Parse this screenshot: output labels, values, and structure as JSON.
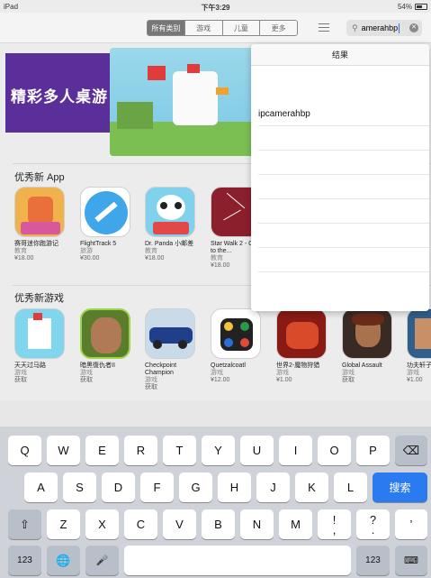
{
  "status": {
    "device": "iPad",
    "time": "下午3:29",
    "battery": "54%"
  },
  "nav": {
    "segments": [
      "所有类别",
      "游戏",
      "儿童",
      "更多"
    ],
    "selected_segment": "所有类别",
    "search_value": "amerahbp",
    "search_icon": "magnifier-icon",
    "clear_icon": "clear-icon"
  },
  "banner": {
    "headline": "精彩多人桌游"
  },
  "sections": [
    {
      "title": "优秀新 App",
      "apps": [
        {
          "name": "赛哥迷你跑游记",
          "category": "教育",
          "price": "¥18.00"
        },
        {
          "name": "FlightTrack 5",
          "category": "旅游",
          "price": "¥30.00"
        },
        {
          "name": "Dr. Panda 小邮差",
          "category": "教育",
          "price": "¥18.00"
        },
        {
          "name": "Star Walk 2 - Guide to the...",
          "category": "教育",
          "price": "¥18.00"
        }
      ]
    },
    {
      "title": "优秀新游戏",
      "apps": [
        {
          "name": "天天过马路",
          "category": "游戏",
          "price": "获取"
        },
        {
          "name": "暗黑復仇者II",
          "category": "游戏",
          "price": "获取"
        },
        {
          "name": "Checkpoint Champion",
          "category": "游戏",
          "price": "获取"
        },
        {
          "name": "Quetzalcoatl",
          "category": "游戏",
          "price": "¥12.00"
        },
        {
          "name": "世界2-魔物狩猎",
          "category": "游戏",
          "price": "¥1.00"
        },
        {
          "name": "Global Assault",
          "category": "游戏",
          "price": "获取"
        },
        {
          "name": "功夫轩子",
          "category": "游戏",
          "price": "¥1.00"
        }
      ]
    }
  ],
  "results": {
    "header": "结果",
    "items": [
      "ipcamerahbp"
    ]
  },
  "keyboard": {
    "row1": [
      "Q",
      "W",
      "E",
      "R",
      "T",
      "Y",
      "U",
      "I",
      "O",
      "P"
    ],
    "row2": [
      "A",
      "S",
      "D",
      "F",
      "G",
      "H",
      "J",
      "K",
      "L"
    ],
    "row3": [
      "Z",
      "X",
      "C",
      "V",
      "B",
      "N",
      "M",
      "!",
      ",",
      "?",
      "."
    ],
    "search_label": "搜索",
    "numbers_label": "123"
  }
}
